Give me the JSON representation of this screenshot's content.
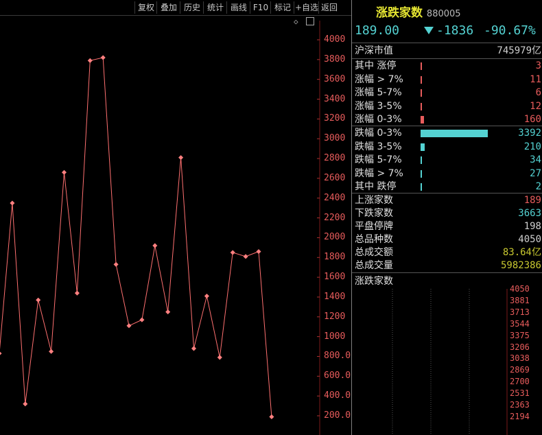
{
  "toolbar": {
    "buttons": [
      "复权",
      "叠加",
      "历史",
      "统计",
      "画线",
      "F10",
      "标记",
      "+自选",
      "返回"
    ]
  },
  "header": {
    "title": "涨跌家数",
    "code": "880005",
    "price": "189.00",
    "change": "-1836",
    "change_pct": "-90.67%"
  },
  "stats": {
    "market_cap_label": "沪深市值",
    "market_cap_value": "745979亿",
    "up_rows": [
      {
        "label": "其中 涨停",
        "value": "3",
        "fill": 0.004
      },
      {
        "label": "涨幅 > 7%",
        "value": "11",
        "fill": 0.004
      },
      {
        "label": "涨幅 5-7%",
        "value": "6",
        "fill": 0.004
      },
      {
        "label": "涨幅 3-5%",
        "value": "12",
        "fill": 0.004
      },
      {
        "label": "涨幅 0-3%",
        "value": "160",
        "fill": 0.05
      }
    ],
    "down_rows": [
      {
        "label": "跌幅 0-3%",
        "value": "3392",
        "fill": 1.0
      },
      {
        "label": "跌幅 3-5%",
        "value": "210",
        "fill": 0.062
      },
      {
        "label": "跌幅 5-7%",
        "value": "34",
        "fill": 0.01
      },
      {
        "label": "跌幅 > 7%",
        "value": "27",
        "fill": 0.008
      },
      {
        "label": "其中 跌停",
        "value": "2",
        "fill": 0.004
      }
    ],
    "summary": [
      {
        "label": "上涨家数",
        "value": "189",
        "color": "#e85c5c"
      },
      {
        "label": "下跌家数",
        "value": "3663",
        "color": "#54d2d2"
      },
      {
        "label": "平盘停牌",
        "value": "198",
        "color": "#d0d0d0"
      },
      {
        "label": "总品种数",
        "value": "4050",
        "color": "#d0d0d0"
      },
      {
        "label": "总成交额",
        "value": "83.64亿",
        "color": "#c8c830"
      },
      {
        "label": "总成交量",
        "value": "5982386",
        "color": "#c8c830"
      }
    ],
    "mini_title": "涨跌家数",
    "mini_ticks": [
      "4050",
      "3881",
      "3713",
      "3544",
      "3375",
      "3206",
      "3038",
      "2869",
      "2700",
      "2531",
      "2363",
      "2194"
    ]
  },
  "colors": {
    "up": "#e85c5c",
    "down": "#54d2d2",
    "title": "#e6e632",
    "line": "#ff7070"
  },
  "chart_data": {
    "type": "line",
    "yticks": [
      "4000",
      "3800",
      "3600",
      "3400",
      "3200",
      "3000",
      "2800",
      "2600",
      "2400",
      "2200",
      "2000",
      "1800",
      "1600",
      "1400",
      "1200",
      "1000",
      "800.0",
      "600.0",
      "400.0",
      "200.0"
    ],
    "ylim": [
      200,
      4000
    ],
    "x": [
      0,
      1,
      2,
      3,
      4,
      5,
      6,
      7,
      8,
      9,
      10,
      11,
      12,
      13,
      14,
      15,
      16,
      17,
      18,
      19,
      20,
      21
    ],
    "values": [
      830,
      2350,
      320,
      1370,
      850,
      2660,
      1440,
      3790,
      3820,
      1730,
      1110,
      1170,
      1920,
      1250,
      2810,
      880,
      1410,
      790,
      1850,
      1810,
      1860,
      190
    ]
  }
}
